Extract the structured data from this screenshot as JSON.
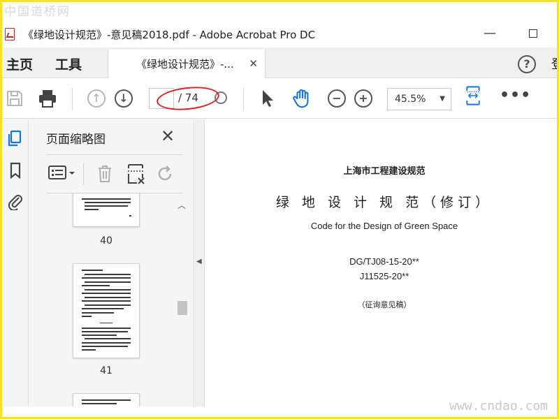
{
  "watermarks": {
    "top": "中国道桥网",
    "bottom": "www.cndao.com"
  },
  "window": {
    "title": "《绿地设计规范》-意见稿2018.pdf - Adobe Acrobat Pro DC",
    "minimize": "—"
  },
  "menu": {
    "home": "主页",
    "tools": "工具",
    "partial": "登"
  },
  "tab": {
    "label": "《绿地设计规范》-...",
    "close": "✕"
  },
  "toolbar": {
    "page_current": "",
    "page_total": "/ 74",
    "zoom": "45.5%",
    "more": "•••",
    "icons": [
      "save-icon",
      "print-icon",
      "page-up-icon",
      "page-down-icon",
      "select-cursor-icon",
      "hand-tool-icon",
      "zoom-out-icon",
      "zoom-in-icon",
      "fit-page-icon",
      "more-icon"
    ],
    "highlight_color": "#e02020",
    "accent_color": "#1473e6"
  },
  "panel": {
    "title": "页面缩略图",
    "close": "✕",
    "icons": [
      "thumbnail-options-icon",
      "delete-icon",
      "extract-page-icon",
      "rotate-icon"
    ],
    "thumbnails": [
      {
        "page": "40"
      },
      {
        "page": "41"
      }
    ]
  },
  "document": {
    "org": "上海市工程建设规范",
    "title": "绿 地 设 计 规 范（修订）",
    "en_title": "Code for the Design of Green Space",
    "code1": "DG/TJ08-15-20**",
    "code2": "J11525-20**",
    "draft": "（征询意见稿）"
  },
  "frame_color": "#f4e41c"
}
